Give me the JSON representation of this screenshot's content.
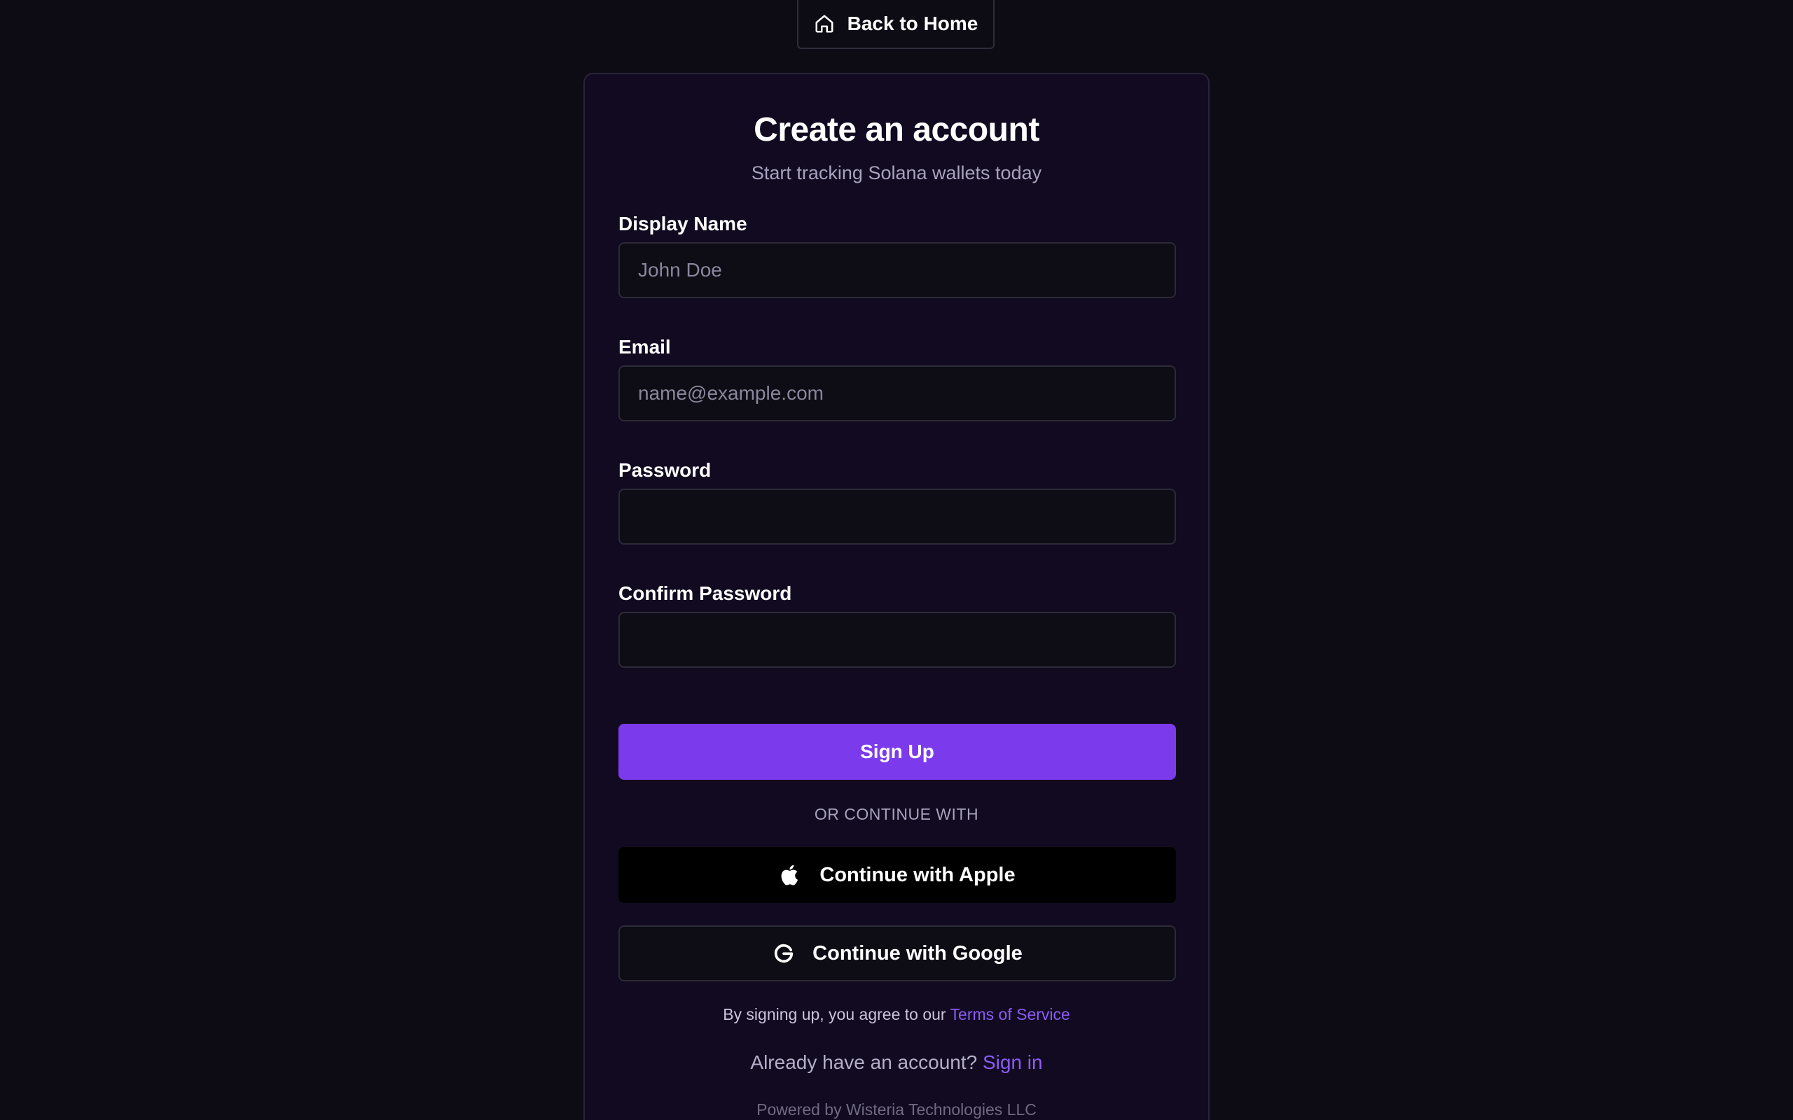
{
  "nav": {
    "back_label": "Back to Home",
    "back_icon": "home-icon"
  },
  "card": {
    "title": "Create an account",
    "subtitle": "Start tracking Solana wallets today"
  },
  "form": {
    "display_name": {
      "label": "Display Name",
      "placeholder": "John Doe",
      "value": ""
    },
    "email": {
      "label": "Email",
      "placeholder": "name@example.com",
      "value": ""
    },
    "password": {
      "label": "Password",
      "placeholder": "",
      "value": ""
    },
    "confirm_password": {
      "label": "Confirm Password",
      "placeholder": "",
      "value": ""
    },
    "submit_label": "Sign Up"
  },
  "social": {
    "divider": "OR CONTINUE WITH",
    "apple_label": "Continue with Apple",
    "apple_icon": "apple-icon",
    "google_label": "Continue with Google",
    "google_icon": "google-icon"
  },
  "footer": {
    "terms_prefix": "By signing up, you agree to our ",
    "terms_link": "Terms of Service",
    "signin_prefix": "Already have an account? ",
    "signin_link": "Sign in",
    "powered_by": "Powered by Wisteria Technologies LLC"
  },
  "colors": {
    "background": "#0d0b14",
    "card": "#120a21",
    "accent": "#7c3aed",
    "link": "#8b5cf6"
  }
}
